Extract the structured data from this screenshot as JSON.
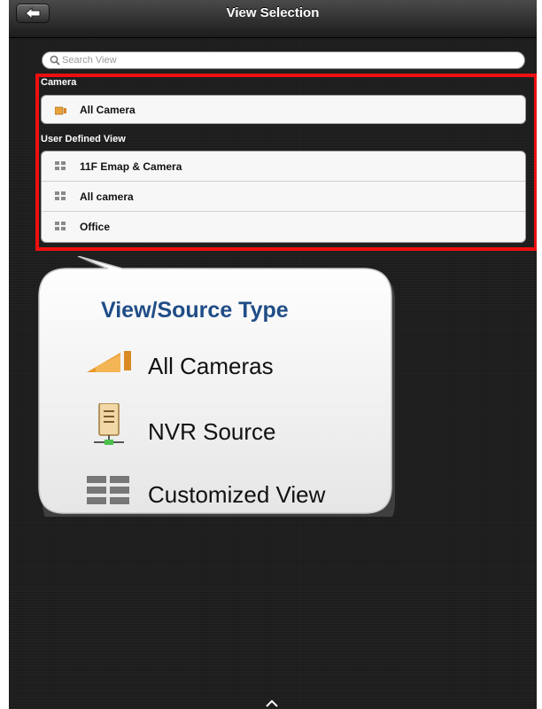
{
  "navbar": {
    "title": "View Selection",
    "back_icon": "back-arrow-icon"
  },
  "search": {
    "placeholder": "Search View",
    "value": "",
    "icon": "magnifier-icon"
  },
  "sections": {
    "camera": {
      "header": "Camera",
      "items": [
        {
          "label": "All Camera",
          "icon": "camera-icon"
        }
      ]
    },
    "user_defined": {
      "header": "User Defined View",
      "items": [
        {
          "label": "11F Emap & Camera",
          "icon": "grid-view-icon"
        },
        {
          "label": "All camera",
          "icon": "grid-view-icon"
        },
        {
          "label": "Office",
          "icon": "grid-view-icon"
        }
      ]
    }
  },
  "callout": {
    "title": "View/Source Type",
    "legend": [
      {
        "label": "All Cameras",
        "icon": "camera-icon"
      },
      {
        "label": "NVR Source",
        "icon": "nvr-server-icon"
      },
      {
        "label": "Customized View",
        "icon": "grid-view-icon"
      }
    ]
  },
  "colors": {
    "highlight": "#ee0f0f",
    "callout_title": "#1f4d87",
    "background": "#1e1e1e"
  }
}
